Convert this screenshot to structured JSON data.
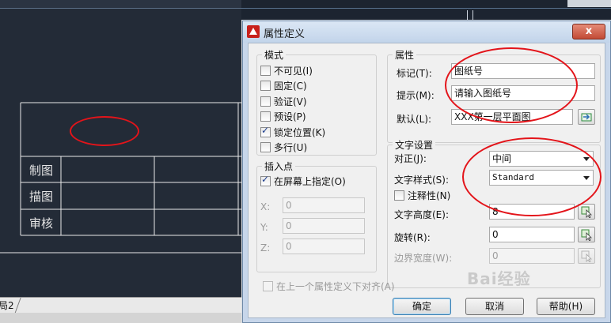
{
  "cad": {
    "table_rows": [
      "制图",
      "描图",
      "审核"
    ],
    "layout_tab": "局2"
  },
  "dialog": {
    "title": "属性定义",
    "close_label": "x",
    "mode": {
      "title": "模式",
      "options": [
        {
          "label": "不可见(I)",
          "checked": false
        },
        {
          "label": "固定(C)",
          "checked": false
        },
        {
          "label": "验证(V)",
          "checked": false
        },
        {
          "label": "预设(P)",
          "checked": false
        },
        {
          "label": "锁定位置(K)",
          "checked": true
        },
        {
          "label": "多行(U)",
          "checked": false
        }
      ]
    },
    "attribute": {
      "title": "属性",
      "tag_label": "标记(T):",
      "tag_value": "图纸号",
      "prompt_label": "提示(M):",
      "prompt_value": "请输入图纸号",
      "default_label": "默认(L):",
      "default_value": "XXX第一层平面图"
    },
    "insert_point": {
      "title": "插入点",
      "specify_on_screen": "在屏幕上指定(O)",
      "x_label": "X:",
      "x_value": "0",
      "y_label": "Y:",
      "y_value": "0",
      "z_label": "Z:",
      "z_value": "0"
    },
    "text_settings": {
      "title": "文字设置",
      "justify_label": "对正(J):",
      "justify_value": "中间",
      "style_label": "文字样式(S):",
      "style_value": "Standard",
      "annotative_label": "注释性(N)",
      "height_label": "文字高度(E):",
      "height_value": "8",
      "rotation_label": "旋转(R):",
      "rotation_value": "0",
      "boundary_label": "边界宽度(W):",
      "boundary_value": "0"
    },
    "align_below": "在上一个属性定义下对齐(A)",
    "buttons": {
      "ok": "确定",
      "cancel": "取消",
      "help": "帮助(H)"
    }
  },
  "watermark": "Bai经验",
  "colors": {
    "highlight_ellipse": "#e3141a",
    "dialog_frame": "#c7d6ea",
    "close_button": "#c24a35"
  }
}
